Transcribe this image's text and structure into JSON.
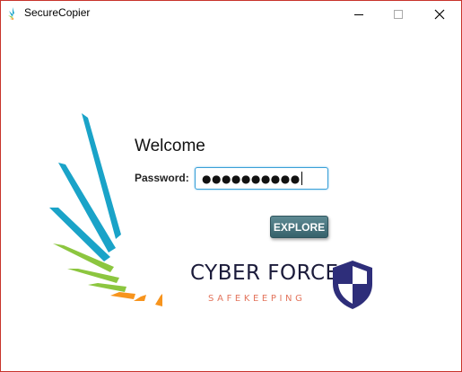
{
  "window": {
    "title": "SecureCopier",
    "border_color": "#c8342c"
  },
  "titlebar": {
    "app_icon": "wing-logo-icon",
    "controls": [
      "minimize-icon",
      "maximize-icon",
      "close-icon"
    ]
  },
  "login": {
    "welcome": "Welcome",
    "password_label": "Password:",
    "password_value": "●●●●●●●●●●",
    "explore_label": "EXPLORE"
  },
  "brand": {
    "name": "CYBER FORCE",
    "tagline": "SAFEKEEPING",
    "logo_icon": "wing-logo-icon",
    "shield_icon": "shield-icon",
    "colors": {
      "blue": "#1aa3c8",
      "green": "#8cc63f",
      "orange": "#f7941d",
      "navy": "#2e2e7a",
      "tagline": "#e3745c",
      "button": "#3f6b75"
    }
  }
}
